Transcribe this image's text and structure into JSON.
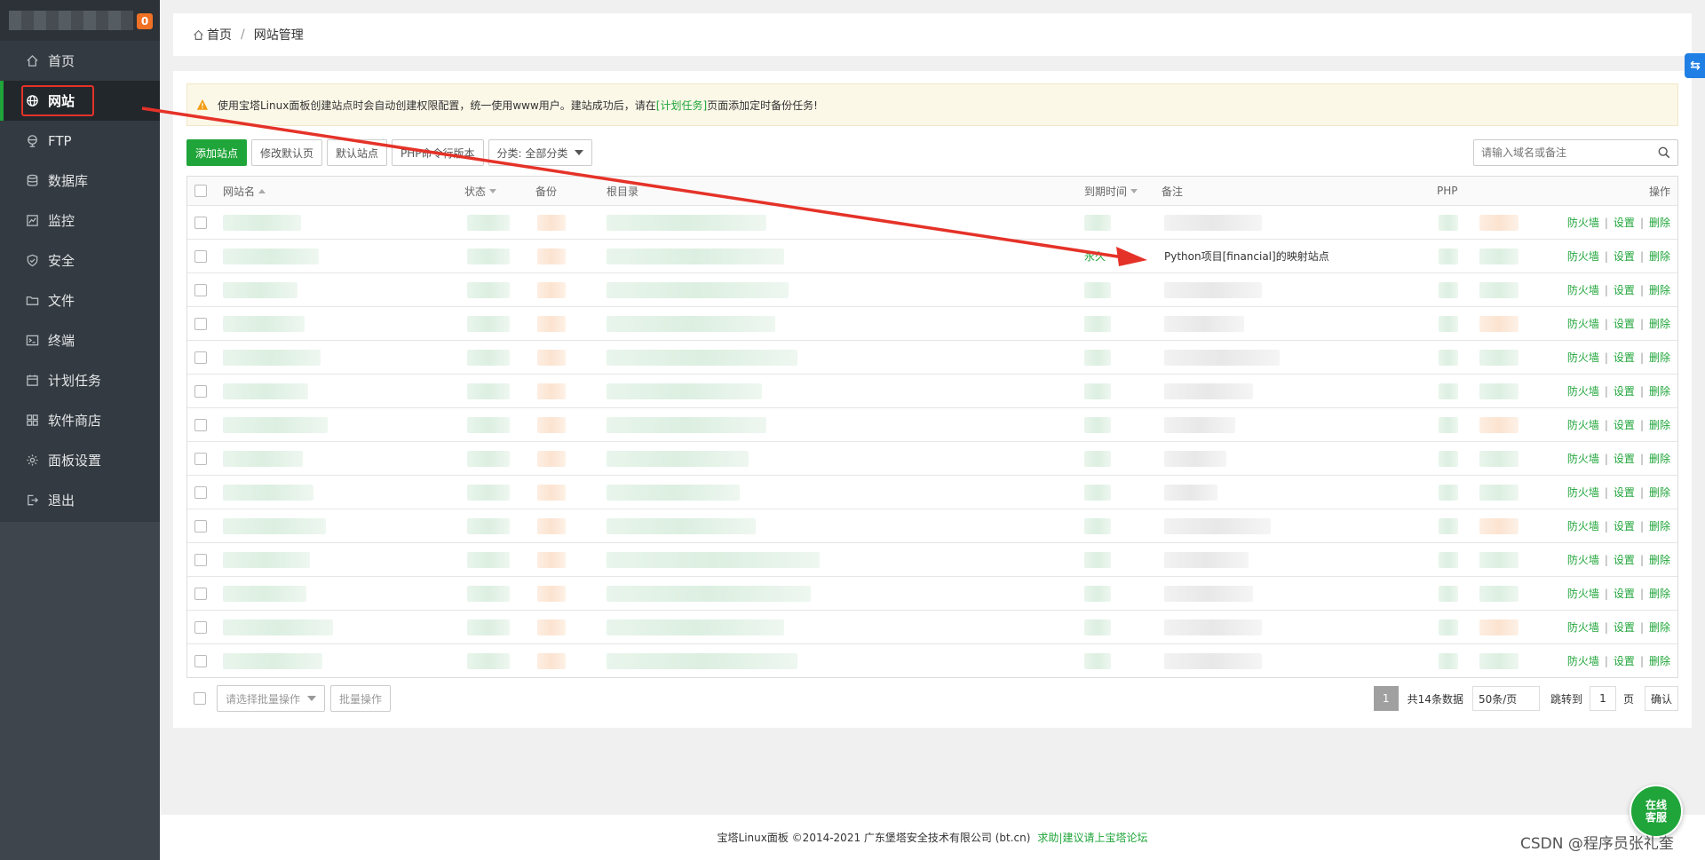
{
  "sidebar": {
    "badge": "0",
    "items": [
      {
        "label": "首页",
        "icon": "home-icon",
        "active": false
      },
      {
        "label": "网站",
        "icon": "globe-icon",
        "active": true
      },
      {
        "label": "FTP",
        "icon": "ftp-icon",
        "active": false
      },
      {
        "label": "数据库",
        "icon": "database-icon",
        "active": false
      },
      {
        "label": "监控",
        "icon": "monitor-icon",
        "active": false
      },
      {
        "label": "安全",
        "icon": "shield-icon",
        "active": false
      },
      {
        "label": "文件",
        "icon": "folder-icon",
        "active": false
      },
      {
        "label": "终端",
        "icon": "terminal-icon",
        "active": false
      },
      {
        "label": "计划任务",
        "icon": "calendar-icon",
        "active": false
      },
      {
        "label": "软件商店",
        "icon": "apps-icon",
        "active": false
      },
      {
        "label": "面板设置",
        "icon": "gear-icon",
        "active": false
      },
      {
        "label": "退出",
        "icon": "logout-icon",
        "active": false
      }
    ]
  },
  "breadcrumb": {
    "home": "首页",
    "separator": "/",
    "current": "网站管理"
  },
  "notice": {
    "text_before": "使用宝塔Linux面板创建站点时会自动创建权限配置，统一使用www用户。建站成功后，请在",
    "link": "[计划任务]",
    "text_after": "页面添加定时备份任务!"
  },
  "toolbar": {
    "add_site": "添加站点",
    "modify_default_page": "修改默认页",
    "default_site": "默认站点",
    "php_cli_version": "PHP命令行版本",
    "category": "分类: 全部分类",
    "search_placeholder": "请输入域名或备注"
  },
  "table": {
    "headers": {
      "name": "网站名",
      "status": "状态",
      "backup": "备份",
      "root": "根目录",
      "expire": "到期时间",
      "remark": "备注",
      "php": "PHP",
      "ops": "操作"
    },
    "rows": [
      {
        "expire": "",
        "remark": ""
      },
      {
        "expire": "永久",
        "remark": "Python项目[financial]的映射站点"
      },
      {
        "expire": "",
        "remark": ""
      },
      {
        "expire": "",
        "remark": ""
      },
      {
        "expire": "",
        "remark": ""
      },
      {
        "expire": "",
        "remark": ""
      },
      {
        "expire": "",
        "remark": ""
      },
      {
        "expire": "",
        "remark": ""
      },
      {
        "expire": "",
        "remark": ""
      },
      {
        "expire": "",
        "remark": ""
      },
      {
        "expire": "",
        "remark": ""
      },
      {
        "expire": "",
        "remark": ""
      },
      {
        "expire": "",
        "remark": ""
      },
      {
        "expire": "",
        "remark": ""
      }
    ],
    "ops": {
      "firewall": "防火墙",
      "settings": "设置",
      "delete": "删除",
      "sep": "|"
    }
  },
  "batch": {
    "select_placeholder": "请选择批量操作",
    "button": "批量操作"
  },
  "pager": {
    "current": "1",
    "total": "共14条数据",
    "per_page": "50条/页",
    "jump_label": "跳转到",
    "jump_value": "1",
    "page_unit": "页",
    "confirm": "确认"
  },
  "footer": {
    "copyright": "宝塔Linux面板 ©2014-2021 广东堡塔安全技术有限公司 (bt.cn)",
    "help_link": "求助|建议请上宝塔论坛"
  },
  "online_service": {
    "line1": "在线",
    "line2": "客服"
  },
  "watermark": "CSDN @程序员张礼奎",
  "colors": {
    "accent": "#20a53a",
    "sidebar": "#333a41",
    "highlight": "#e53228",
    "badge": "#f07126"
  }
}
